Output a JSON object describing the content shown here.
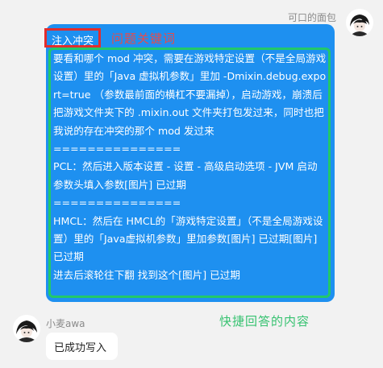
{
  "chat": {
    "top_sender": "可口的面包",
    "keyword_label": "注入冲突",
    "keyword_annotation": "问题关键词",
    "reply_content": "要看和哪个 mod 冲突，需要在游戏特定设置（不是全局游戏设置）里的「Java 虚拟机参数」里加 -Dmixin.debug.export=true （参数最前面的横杠不要漏掉），启动游戏，崩溃后把游戏文件夹下的 .mixin.out 文件夹打包发过来，同时也把我说的存在冲突的那个 mod 发过来\n===============\nPCL：然后进入版本设置 - 设置 - 高级启动选项 - JVM 启动参数头填入参数[图片] 已过期\n===============\nHMCL：然后在 HMCL的「游戏特定设置」（不是全局游戏设置）里的「Java虚拟机参数」里加参数[图片] 已过期[图片] 已过期\n进去后滚轮往下翻 找到这个[图片] 已过期",
    "reply_annotation": "快捷回答的内容",
    "bottom_sender": "小麦awa",
    "bottom_message": "已成功写入"
  },
  "icons": {
    "top_avatar": "user-avatar-icon",
    "bottom_avatar": "user-avatar-icon"
  }
}
